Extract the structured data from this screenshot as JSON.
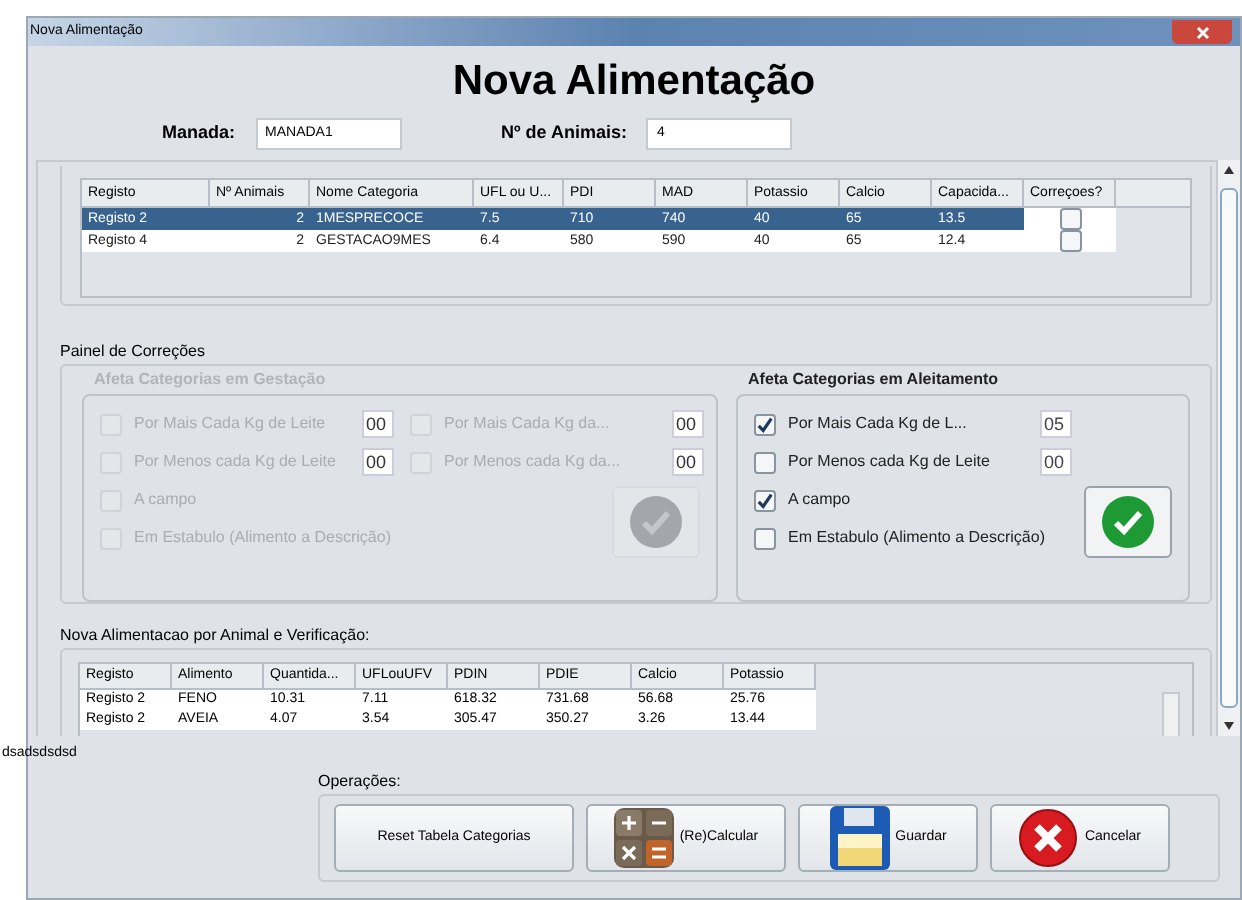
{
  "window": {
    "title": "Nova Alimentação"
  },
  "heading": "Nova Alimentação",
  "fields": [
    {
      "label": "Manada:",
      "value": "MANADA1"
    },
    {
      "label": "Nº de Animais:",
      "value": "4"
    }
  ],
  "categories_table": {
    "columns": [
      "Registo",
      "Nº Animais",
      "Nome Categoria",
      "UFL ou U...",
      "PDI",
      "MAD",
      "Potassio",
      "Calcio",
      "Capacida...",
      "Correçoes?"
    ],
    "rows": [
      {
        "cells": [
          "Registo 2",
          "2",
          "1MESPRECOCE",
          "7.5",
          "710",
          "740",
          "40",
          "65",
          "13.5"
        ],
        "checked": false,
        "selected": true
      },
      {
        "cells": [
          "Registo 4",
          "2",
          "GESTACAO9MES",
          "6.4",
          "580",
          "590",
          "40",
          "65",
          "12.4"
        ],
        "checked": false,
        "selected": false
      }
    ]
  },
  "corrections": {
    "title": "Painel de Correções",
    "groups": [
      {
        "title": "Afeta Categorias  em Gestação",
        "disabled": true,
        "options": [
          {
            "label": "Por Mais Cada Kg de Leite",
            "checked": false,
            "value": "00"
          },
          {
            "label": "Por Mais Cada Kg da...",
            "checked": false,
            "value": "00"
          },
          {
            "label": "Por Menos cada Kg de Leite",
            "checked": false,
            "value": "00"
          },
          {
            "label": "Por Menos cada Kg da...",
            "checked": false,
            "value": "00"
          },
          {
            "label": "A campo",
            "checked": false
          },
          {
            "label": "Em Estabulo (Alimento a Descrição)",
            "checked": false
          }
        ]
      },
      {
        "title": "Afeta Categorias em Aleitamento",
        "disabled": false,
        "options": [
          {
            "label": "Por Mais Cada Kg de L...",
            "checked": true,
            "value": "05"
          },
          {
            "label": "Por Menos cada Kg de Leite",
            "checked": false,
            "value": "00"
          },
          {
            "label": "A campo",
            "checked": true
          },
          {
            "label": "Em Estabulo (Alimento a Descrição)",
            "checked": false
          }
        ]
      }
    ]
  },
  "feed_table": {
    "title": "Nova Alimentacao por Animal e Verificação:",
    "columns": [
      "Registo",
      "Alimento",
      "Quantida...",
      "UFLouUFV",
      "PDIN",
      "PDIE",
      "Calcio",
      "Potassio"
    ],
    "rows": [
      [
        "Registo 2",
        "FENO",
        "10.31",
        "7.11",
        "618.32",
        "731.68",
        "56.68",
        "25.76"
      ],
      [
        "Registo 2",
        "AVEIA",
        "4.07",
        "3.54",
        "305.47",
        "350.27",
        "3.26",
        "13.44"
      ]
    ]
  },
  "status_text": "dsadsdsdsd",
  "operations": {
    "title": "Operações:",
    "buttons": [
      {
        "label": "Reset Tabela Categorias",
        "kind": "plain"
      },
      {
        "label": "(Re)Calcular",
        "kind": "calculator"
      },
      {
        "label": "Guardar",
        "kind": "save"
      },
      {
        "label": "Cancelar",
        "kind": "cancel"
      }
    ]
  }
}
